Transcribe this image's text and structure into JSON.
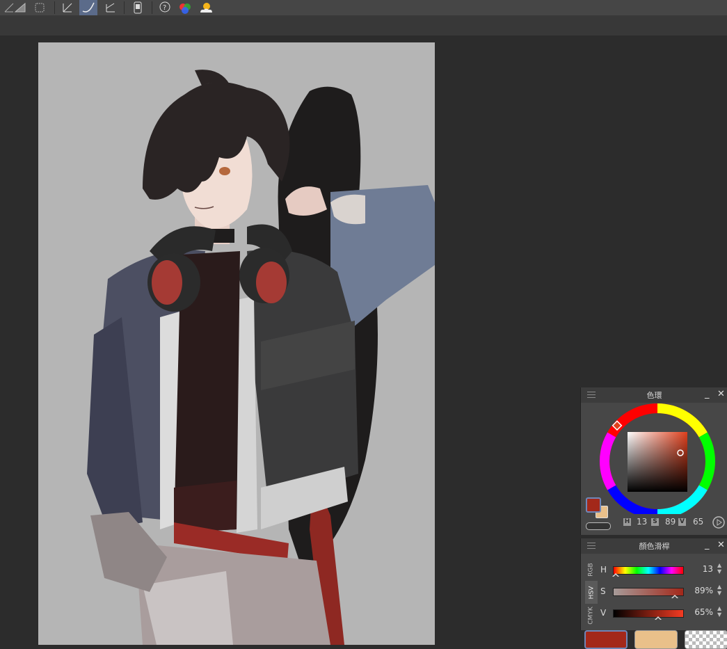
{
  "toolbar": {
    "icons": [
      "ruler-icon",
      "ruler-hatched-icon",
      "frame-icon",
      "line-edit-icon",
      "pen-curve-icon",
      "line-corner-icon",
      "phone-preview-icon",
      "help-icon",
      "color-circle-icon",
      "weather-icon"
    ],
    "active_index": 4
  },
  "color_wheel": {
    "title": "色環",
    "main_color": "#a3281a",
    "sub_color": "#e9c08a",
    "h_label": "H",
    "h_value": "13",
    "s_label": "S",
    "s_value": "89",
    "v_label": "V",
    "v_value": "65",
    "minimize": "_",
    "close": "✕"
  },
  "color_slider": {
    "title": "顏色滑桿",
    "tabs": [
      "RGB",
      "HSV",
      "CMYK"
    ],
    "active_tab": "HSV",
    "rows": [
      {
        "label": "H",
        "value": "13",
        "level": 0.04
      },
      {
        "label": "S",
        "value": "89%",
        "level": 0.89
      },
      {
        "label": "V",
        "value": "65%",
        "level": 0.65
      }
    ],
    "minimize": "_",
    "close": "✕"
  },
  "swatches": [
    {
      "color": "#a3281a",
      "name": "main"
    },
    {
      "color": "#e9c08a",
      "name": "sub"
    },
    {
      "color": "transparent",
      "name": "transparent"
    }
  ]
}
